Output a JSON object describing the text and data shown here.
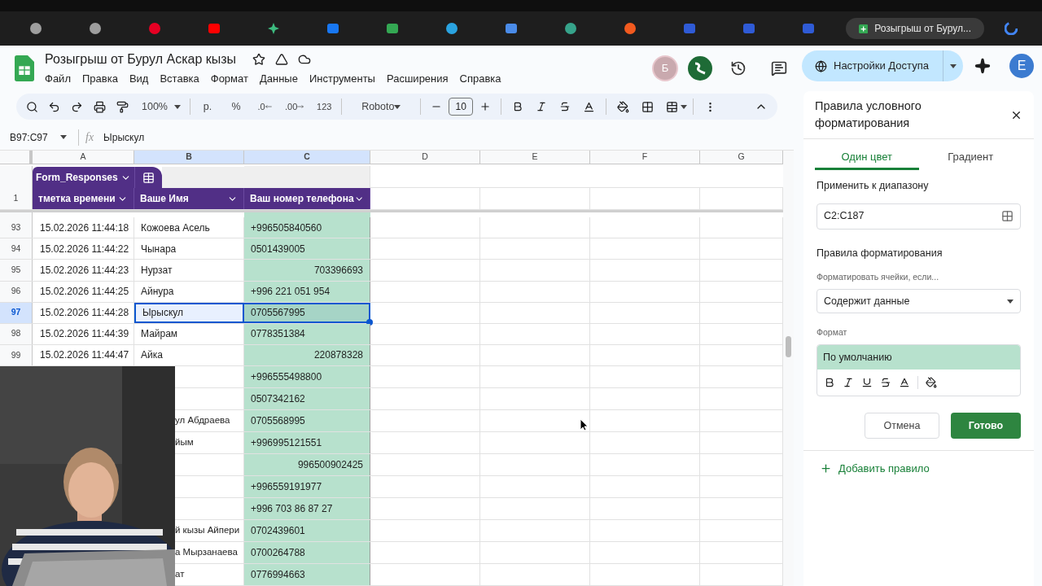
{
  "browser": {
    "active_tab": {
      "title": "Розыгрыш от Бурул..."
    }
  },
  "document": {
    "title": "Розыгрыш от Бурул Аскар кызы",
    "menu": [
      "Файл",
      "Правка",
      "Вид",
      "Вставка",
      "Формат",
      "Данные",
      "Инструменты",
      "Расширения",
      "Справка"
    ]
  },
  "collaborators": [
    {
      "initial": "Б",
      "kind": "letter",
      "color": "#c9a9ae"
    },
    {
      "kind": "squiggle",
      "color": "#1e6b36"
    }
  ],
  "share_button": {
    "label": "Настройки Доступа"
  },
  "account": {
    "initial": "E"
  },
  "toolbar": {
    "zoom": "100%",
    "currency": "р.",
    "percent": "%",
    "decrease_decimals": ".0",
    "increase_decimals": ".00",
    "number_format": "123",
    "font": "Roboto",
    "font_size": "10"
  },
  "formula_bar": {
    "cell_reference": "B97:C97",
    "function_label": "fx",
    "value": "Ырыскул"
  },
  "columns": [
    {
      "letter": "A",
      "selected": false
    },
    {
      "letter": "B",
      "selected": true
    },
    {
      "letter": "C",
      "selected": true
    },
    {
      "letter": "D",
      "selected": false
    },
    {
      "letter": "E",
      "selected": false
    },
    {
      "letter": "F",
      "selected": false
    },
    {
      "letter": "G",
      "selected": false
    }
  ],
  "table": {
    "name": "Form_Responses",
    "header_row": "1",
    "headers": [
      "тметка времени",
      "Ваше Имя",
      "Ваш номер телефона"
    ]
  },
  "rows": [
    {
      "number": "93",
      "timestamp": "15.02.2026 11:44:18",
      "name": "Кожоева Асель",
      "phone": "+996505840560",
      "kind": "text",
      "selected": false
    },
    {
      "number": "94",
      "timestamp": "15.02.2026 11:44:22",
      "name": "Чынара",
      "phone": "0501439005",
      "kind": "text",
      "selected": false
    },
    {
      "number": "95",
      "timestamp": "15.02.2026 11:44:23",
      "name": "Нурзат",
      "phone": "703396693",
      "kind": "number",
      "selected": false
    },
    {
      "number": "96",
      "timestamp": "15.02.2026 11:44:25",
      "name": "Айнура",
      "phone": "+996 221 051 954",
      "kind": "text",
      "selected": false
    },
    {
      "number": "97",
      "timestamp": "15.02.2026 11:44:28",
      "name": "Ырыскул",
      "phone": "0705567995",
      "kind": "text",
      "selected": true
    },
    {
      "number": "98",
      "timestamp": "15.02.2026 11:44:39",
      "name": "Майрам",
      "phone": "0778351384",
      "kind": "text",
      "selected": false
    },
    {
      "number": "99",
      "timestamp": "15.02.2026 11:44:47",
      "name": "Айка",
      "phone": "220878328",
      "kind": "number",
      "selected": false
    }
  ],
  "rows_under_video": [
    {
      "phone": "+996555498800",
      "kind": "text"
    },
    {
      "phone": "0507342162",
      "kind": "text"
    },
    {
      "name": "ул Абдраева",
      "phone": "0705568995",
      "kind": "text"
    },
    {
      "name": "йым",
      "phone": "+996995121551",
      "kind": "text"
    },
    {
      "phone": "996500902425",
      "kind": "number"
    },
    {
      "phone": "+996559191977",
      "kind": "text"
    },
    {
      "phone": "+996 703 86 87 27",
      "kind": "text"
    },
    {
      "name": "й кызы Айпери",
      "phone": "0702439601",
      "kind": "text"
    },
    {
      "name": "а Мырзанаева",
      "phone": "0700264788",
      "kind": "text"
    },
    {
      "name": "ат",
      "phone": "0776994663",
      "kind": "text"
    }
  ],
  "panel": {
    "title": "Правила условного форматирования",
    "tabs": [
      {
        "label": "Один цвет",
        "selected": true
      },
      {
        "label": "Градиент",
        "selected": false
      }
    ],
    "range_label": "Применить к диапазону",
    "range": "C2:C187",
    "rules_label": "Правила форматирования",
    "condition_label": "Форматировать ячейки, если...",
    "condition": "Содержит данные",
    "format_label": "Формат",
    "preview": "По умолчанию",
    "cancel": "Отмена",
    "done": "Готово",
    "add_rule": "Добавить правило"
  }
}
